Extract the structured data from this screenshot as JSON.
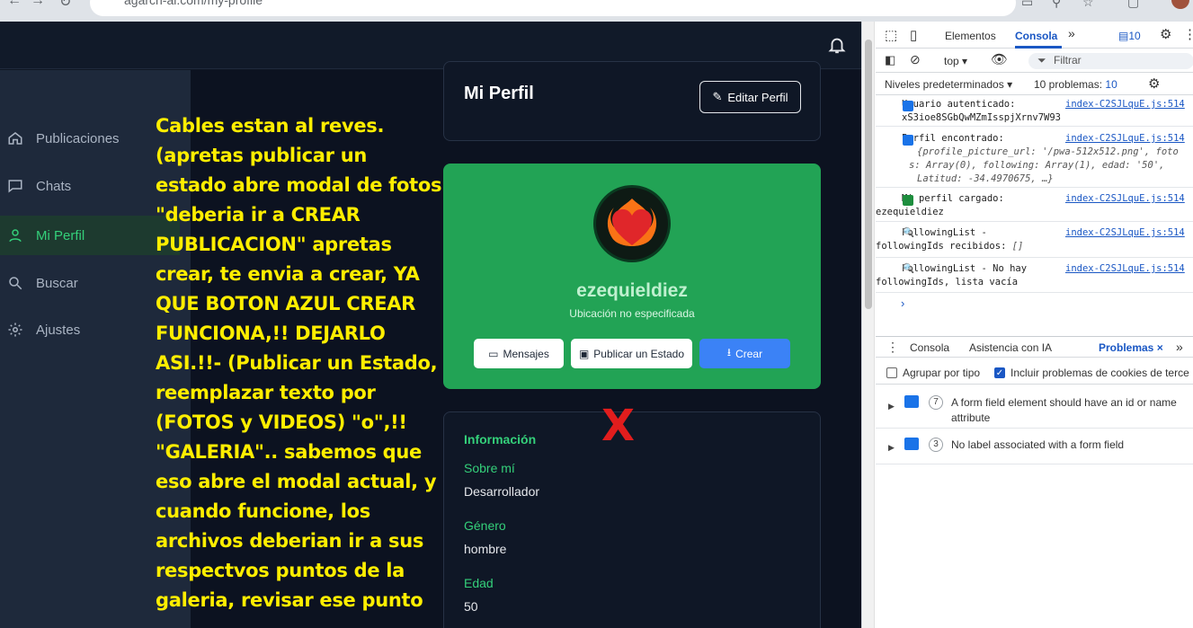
{
  "browser": {
    "url": "agarch-ai.com/my-profile"
  },
  "sidebar": {
    "items": [
      {
        "label": "Publicaciones",
        "icon": "home-icon"
      },
      {
        "label": "Chats",
        "icon": "chat-icon"
      },
      {
        "label": "Mi Perfil",
        "icon": "user-icon",
        "active": true
      },
      {
        "label": "Buscar",
        "icon": "search-icon"
      },
      {
        "label": "Ajustes",
        "icon": "gear-icon"
      }
    ]
  },
  "profile": {
    "title": "Mi Perfil",
    "edit_label": "Editar Perfil",
    "username": "ezequieldiez",
    "location": "Ubicación no especificada",
    "buttons": {
      "messages": "Mensajes",
      "publish": "Publicar un Estado",
      "create": "Crear"
    },
    "info_title": "Información",
    "fields": [
      {
        "label": "Sobre mí",
        "value": "Desarrollador"
      },
      {
        "label": "Género",
        "value": "hombre"
      },
      {
        "label": "Edad",
        "value": "50"
      }
    ]
  },
  "annotation": {
    "note": "Cables estan al reves. (apretas publicar un estado abre modal de fotos \"deberia ir a CREAR PUBLICACION\" apretas crear, te envia a crear,  YA QUE BOTON AZUL CREAR FUNCIONA,!! DEJARLO ASI.!!- (Publicar un Estado, reemplazar texto por (FOTOS y VIDEOS) \"o\",!! \"GALERIA\".. sabemos que eso abre el modal actual, y cuando funcione, los archivos deberian ir a sus respectvos puntos de la galeria, revisar ese punto",
    "mark": "X",
    "mark_color": "#e11d1d"
  },
  "devtools": {
    "tabs": {
      "elements": "Elementos",
      "console": "Consola",
      "issues_badge": "10"
    },
    "toolbar": {
      "context": "top",
      "filter_placeholder": "Filtrar"
    },
    "levels": {
      "label": "Niveles predeterminados",
      "problems": "10 problemas:",
      "problems_count": "10"
    },
    "logs": [
      {
        "line1": "Usuario autenticado:",
        "line2": "xS3ioe8SGbQwMZmIsspjXrnv7W93",
        "src": "index-C2SJLquE.js:514"
      },
      {
        "line1": "Perfil encontrado:",
        "src": "index-C2SJLquE.js:514",
        "line2": "{profile_picture_url: '/pwa-512x512.png', foto",
        "line3": "s: Array(0), following: Array(1), edad: '50',",
        "line4": "Latitud: -34.4970675, …}"
      },
      {
        "line1": "Mi perfil cargado:",
        "line2": "ezequieldiez",
        "src": "index-C2SJLquE.js:514"
      },
      {
        "line1": "FollowingList -",
        "line2": "followingIds recibidos:",
        "extra": "[]",
        "src": "index-C2SJLquE.js:514"
      },
      {
        "line1": "FollowingList - No hay",
        "line2": "followingIds, lista vacía",
        "src": "index-C2SJLquE.js:514"
      }
    ],
    "drawer_tabs": {
      "console": "Consola",
      "ai": "Asistencia con IA",
      "problems": "Problemas"
    },
    "options": {
      "group": "Agrupar por tipo",
      "cookies": "Incluir problemas de cookies de terce"
    },
    "issues": [
      {
        "count": "7",
        "text": "A form field element should have an id or name attribute"
      },
      {
        "count": "3",
        "text": "No label associated with a form field"
      }
    ]
  }
}
